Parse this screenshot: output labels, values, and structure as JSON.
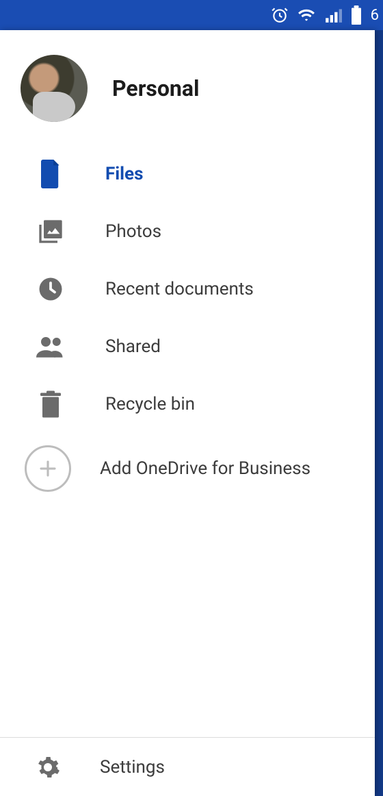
{
  "status": {
    "time_fragment": "6"
  },
  "account": {
    "title": "Personal"
  },
  "nav": {
    "files": "Files",
    "photos": "Photos",
    "recent": "Recent documents",
    "shared": "Shared",
    "recycle": "Recycle bin"
  },
  "add_business": {
    "label": "Add OneDrive for Business"
  },
  "footer": {
    "settings": "Settings"
  },
  "colors": {
    "primary": "#124cb0",
    "statusbar": "#1a4db3",
    "icon_muted": "#6b6b6b"
  }
}
